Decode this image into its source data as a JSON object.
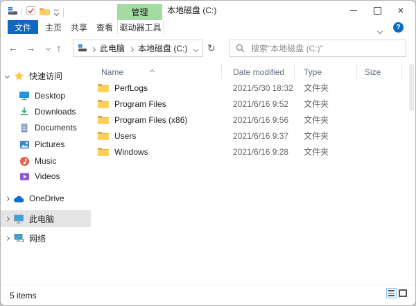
{
  "window": {
    "title": "本地磁盘 (C:)"
  },
  "ribbon": {
    "context_group": "管理",
    "file_tab": "文件",
    "tabs": [
      {
        "label": "主页"
      },
      {
        "label": "共享"
      },
      {
        "label": "查看"
      },
      {
        "label": "驱动器工具"
      }
    ]
  },
  "navbar": {
    "icons": {
      "back": "←",
      "forward": "→",
      "up": "↑",
      "refresh": "↻"
    },
    "crumbs": [
      "此电脑",
      "本地磁盘 (C:)"
    ],
    "search_placeholder": "搜索\"本地磁盘 (C:)\""
  },
  "sidebar": {
    "quick_access": "快速访问",
    "items": [
      {
        "label": "Desktop",
        "pinned": true
      },
      {
        "label": "Downloads",
        "pinned": true
      },
      {
        "label": "Documents",
        "pinned": true
      },
      {
        "label": "Pictures",
        "pinned": true
      },
      {
        "label": "Music",
        "pinned": false
      },
      {
        "label": "Videos",
        "pinned": false
      }
    ],
    "onedrive": "OneDrive",
    "this_pc": "此电脑",
    "network": "网络"
  },
  "file_list": {
    "columns": [
      "Name",
      "Date modified",
      "Type",
      "Size"
    ],
    "rows": [
      {
        "name": "PerfLogs",
        "date": "2021/5/30 18:32",
        "type": "文件夹",
        "size": ""
      },
      {
        "name": "Program Files",
        "date": "2021/6/16 9:52",
        "type": "文件夹",
        "size": ""
      },
      {
        "name": "Program Files (x86)",
        "date": "2021/6/16 9:56",
        "type": "文件夹",
        "size": ""
      },
      {
        "name": "Users",
        "date": "2021/6/16 9:37",
        "type": "文件夹",
        "size": ""
      },
      {
        "name": "Windows",
        "date": "2021/6/16 9:28",
        "type": "文件夹",
        "size": ""
      }
    ]
  },
  "statusbar": {
    "items_text": "5 items"
  },
  "colors": {
    "file_tab_blue": "#1168bf",
    "context_tab_green": "#a3dba3",
    "help_blue": "#0b6cc4",
    "folder_front": "#ffd05c",
    "folder_back": "#e9a23b",
    "selected_row_gray": "#e4e4e4"
  }
}
